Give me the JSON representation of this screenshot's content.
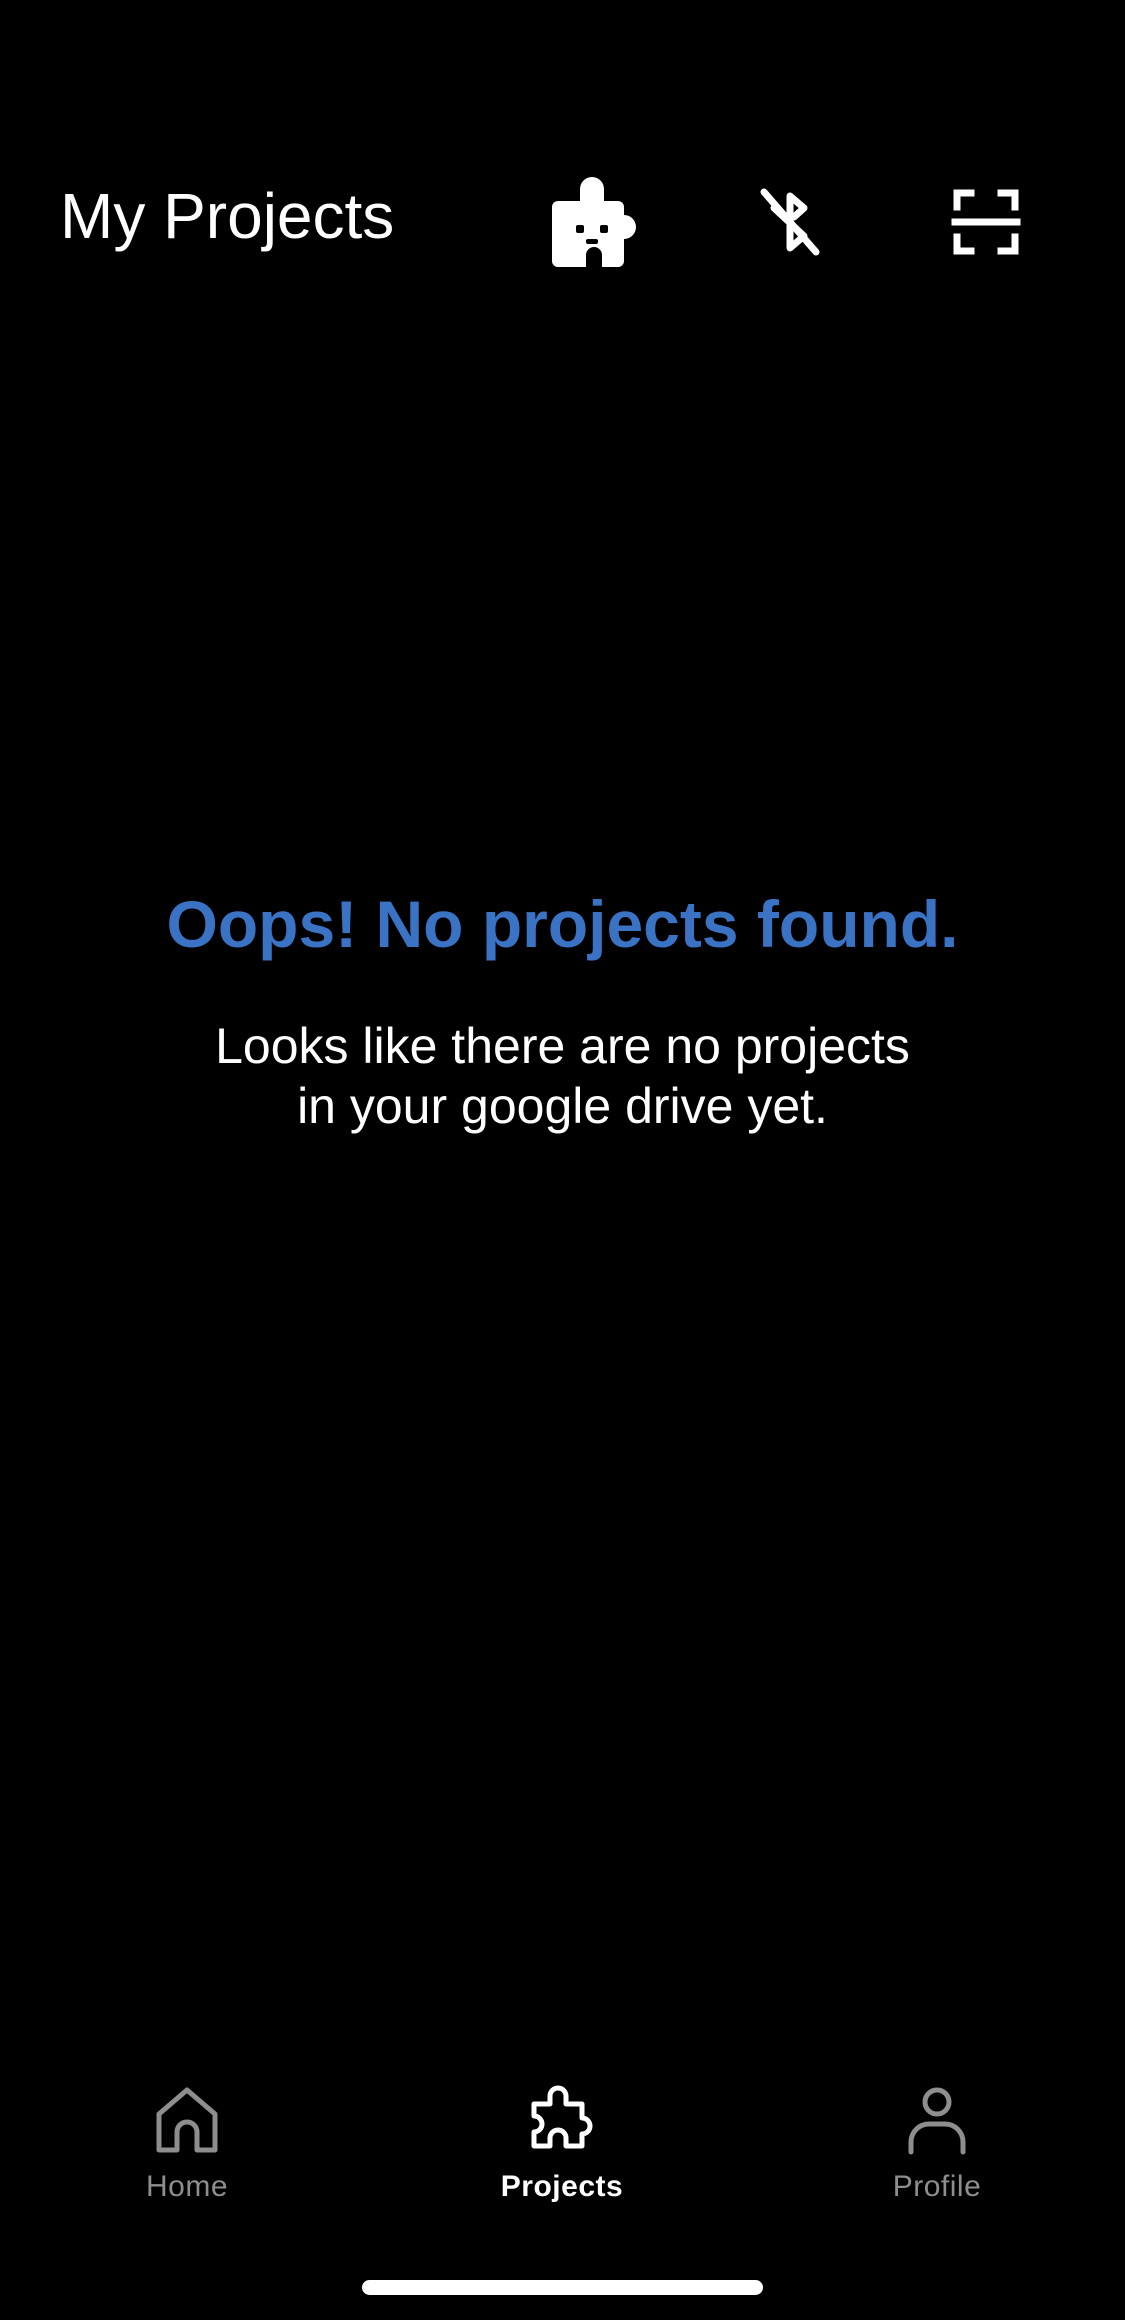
{
  "header": {
    "title": "My Projects",
    "icons": [
      "robot-puzzle-icon",
      "bluetooth-off-icon",
      "scan-frame-icon"
    ]
  },
  "empty_state": {
    "title": "Oops! No projects found.",
    "message_line1": "Looks like there are no projects",
    "message_line2": "in your google drive yet."
  },
  "tabbar": {
    "tabs": [
      {
        "label": "Home",
        "icon": "home-icon",
        "active": false
      },
      {
        "label": "Projects",
        "icon": "puzzle-icon",
        "active": true
      },
      {
        "label": "Profile",
        "icon": "person-icon",
        "active": false
      }
    ]
  },
  "colors": {
    "background": "#000000",
    "accent": "#3a72c4",
    "text": "#ffffff",
    "inactive_tab": "#8e8e8e"
  }
}
